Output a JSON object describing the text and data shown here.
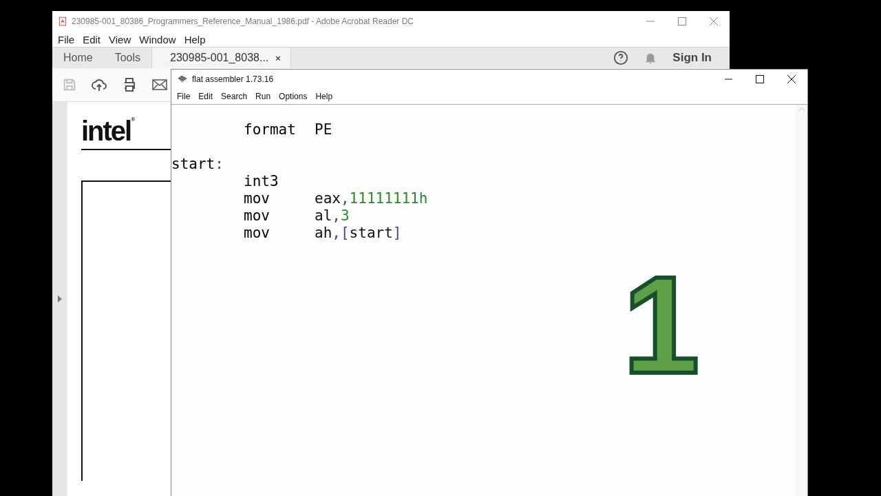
{
  "reader": {
    "title": "230985-001_80386_Programmers_Reference_Manual_1986.pdf - Adobe Acrobat Reader DC",
    "menu": [
      "File",
      "Edit",
      "View",
      "Window",
      "Help"
    ],
    "tabs": [
      {
        "label": "Home",
        "selected": false
      },
      {
        "label": "Tools",
        "selected": false
      },
      {
        "label": "230985-001_8038...",
        "selected": true,
        "close": "×"
      }
    ],
    "sign_in": "Sign In",
    "page": {
      "logo": "intel",
      "logo_mark": "®"
    }
  },
  "assembler": {
    "title": "flat assembler 1.73.16",
    "menu": [
      "File",
      "Edit",
      "Search",
      "Run",
      "Options",
      "Help"
    ],
    "code": [
      {
        "kind": "instruction",
        "mnemonic": "format",
        "operands": [
          {
            "text": "PE",
            "kind": "reg"
          }
        ]
      },
      {
        "kind": "blank"
      },
      {
        "kind": "label",
        "label": "start"
      },
      {
        "kind": "instruction",
        "mnemonic": "int3"
      },
      {
        "kind": "instruction",
        "mnemonic": "mov",
        "operands": [
          {
            "text": "eax",
            "kind": "reg"
          },
          {
            "text": ",",
            "kind": "sym"
          },
          {
            "text": "11111111h",
            "kind": "num"
          }
        ]
      },
      {
        "kind": "instruction",
        "mnemonic": "mov",
        "operands": [
          {
            "text": "al",
            "kind": "reg"
          },
          {
            "text": ",",
            "kind": "sym"
          },
          {
            "text": "3",
            "kind": "num"
          }
        ]
      },
      {
        "kind": "instruction",
        "mnemonic": "mov",
        "operands": [
          {
            "text": "ah",
            "kind": "reg"
          },
          {
            "text": ",",
            "kind": "sym"
          },
          {
            "text": "[",
            "kind": "sym"
          },
          {
            "text": "start",
            "kind": "reg"
          },
          {
            "text": "]",
            "kind": "sym"
          }
        ]
      }
    ],
    "label_suffix": ":"
  },
  "overlay_number": "1"
}
